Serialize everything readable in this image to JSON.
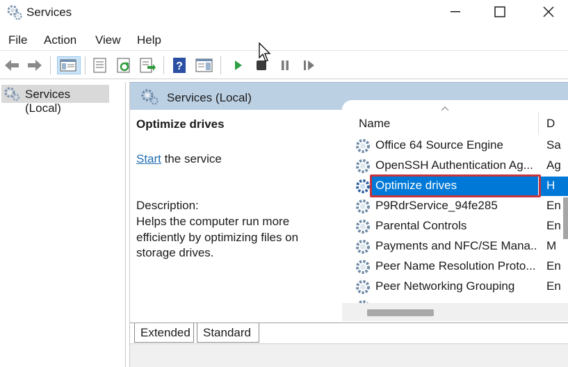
{
  "window": {
    "title": "Services"
  },
  "menu": [
    "File",
    "Action",
    "View",
    "Help"
  ],
  "toolbar": {
    "buttons": [
      "back-icon",
      "forward-icon",
      "show-hide-console-tree-icon",
      "properties-icon",
      "refresh-icon",
      "export-list-icon",
      "help-icon",
      "show-action-pane-icon",
      "start-service-icon",
      "stop-service-icon",
      "pause-service-icon",
      "restart-service-icon"
    ]
  },
  "tree": {
    "selected": "Services (Local)"
  },
  "main": {
    "header": "Services (Local)",
    "detail": {
      "title": "Optimize drives",
      "start_link": "Start",
      "start_suffix": " the service",
      "description_label": "Description:",
      "description_text": "Helps the computer run more efficiently by optimizing files on storage drives."
    },
    "list": {
      "columns": [
        "Name",
        "D"
      ],
      "rows": [
        {
          "name": "Office 64 Source Engine",
          "d": "Sa"
        },
        {
          "name": "OpenSSH Authentication Ag...",
          "d": "Ag"
        },
        {
          "name": "Optimize drives",
          "d": "H",
          "selected": true
        },
        {
          "name": "P9RdrService_94fe285",
          "d": "En"
        },
        {
          "name": "Parental Controls",
          "d": "En"
        },
        {
          "name": "Payments and NFC/SE Mana...",
          "d": "M"
        },
        {
          "name": "Peer Name Resolution Proto...",
          "d": "En"
        },
        {
          "name": "Peer Networking Grouping",
          "d": "En"
        }
      ]
    },
    "tabs": [
      "Extended",
      "Standard"
    ]
  },
  "colors": {
    "selection": "#0078d7",
    "highlight_outline": "#c8343f",
    "header_band": "#bcd0e4",
    "link": "#1f6cb0"
  }
}
